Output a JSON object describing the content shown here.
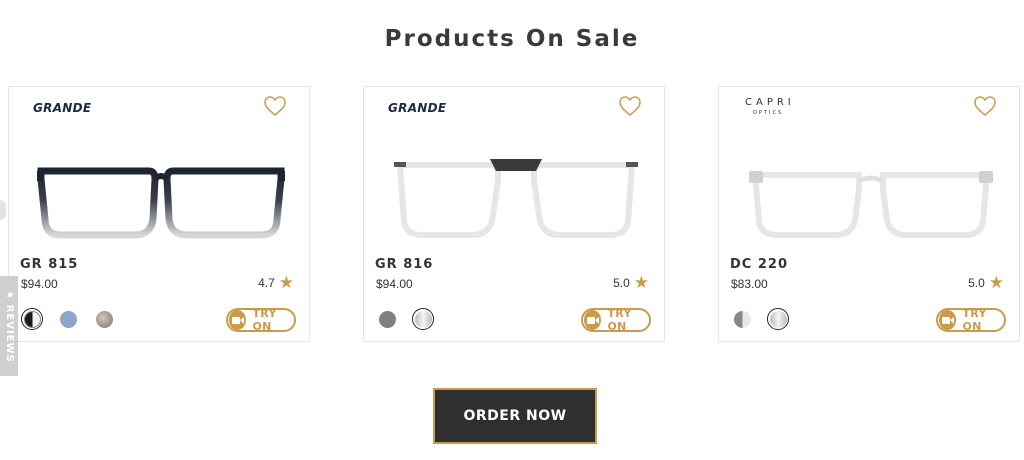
{
  "title": "Products On Sale",
  "products": [
    {
      "brand": "GRANDE",
      "model": "GR 815",
      "price": "$94.00",
      "rating": "4.7",
      "try_on": "TRY ON",
      "swatches": [
        "#1b1b1b",
        "#8fa5c6",
        "#9a8c7e"
      ]
    },
    {
      "brand": "GRANDE",
      "model": "GR 816",
      "price": "$94.00",
      "rating": "5.0",
      "try_on": "TRY ON",
      "swatches": [
        "#808080",
        "#d9d9d9"
      ]
    },
    {
      "brand": "CAPRI",
      "brand_sub": "OPTICS",
      "model": "DC 220",
      "price": "$83.00",
      "rating": "5.0",
      "try_on": "TRY ON",
      "swatches": [
        "#9a9a9a",
        "#d9d9d9"
      ]
    }
  ],
  "order_button": "ORDER NOW",
  "reviews_tab": "★ REVIEWS",
  "colors": {
    "accent": "#c99b4b",
    "button_bg": "#2f2f2f"
  }
}
